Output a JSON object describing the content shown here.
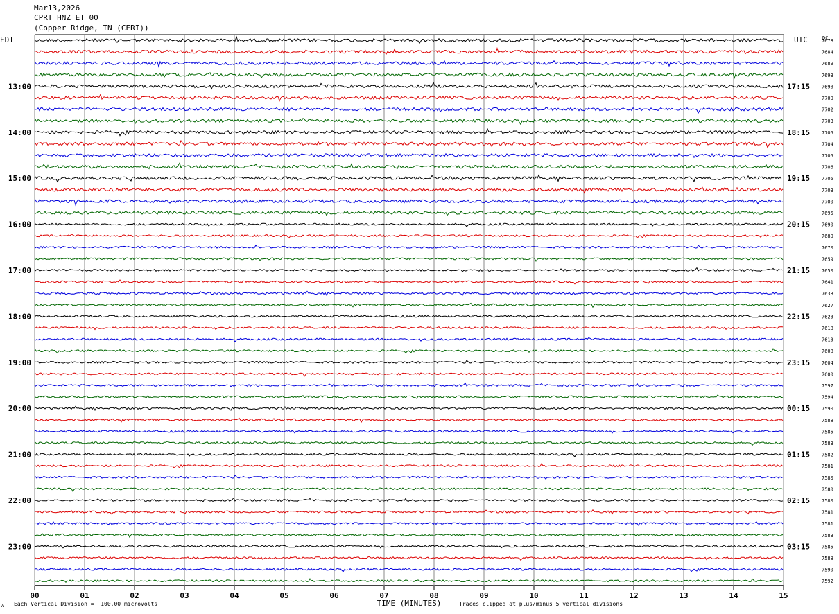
{
  "header": {
    "date": "Mar13,2026",
    "station": "CPRT HNZ ET 00",
    "location": "(Copper Ridge, TN (CERI))"
  },
  "footer": {
    "scale_note": "Each Vertical Division =  100.00 microvolts",
    "clip_note": "Traces clipped at plus/minus 5 vertical divisions",
    "corner_mark": "A"
  },
  "colors": {
    "trace_cycle": [
      "#000000",
      "#dd0000",
      "#0000dd",
      "#006600"
    ],
    "grid": "#888888"
  },
  "chart_data": {
    "type": "line",
    "title": "",
    "xlabel": "TIME (MINUTES)",
    "ylabel": "",
    "left_axis_label": "EDT",
    "right_axis_label": "UTC",
    "dc_label": "DC",
    "xlim": [
      0,
      15
    ],
    "x_ticks": [
      "00",
      "01",
      "02",
      "03",
      "04",
      "05",
      "06",
      "07",
      "08",
      "09",
      "10",
      "11",
      "12",
      "13",
      "14",
      "15"
    ],
    "grid": true,
    "rows_per_hour": 4,
    "rows": [
      {
        "dc": "7678"
      },
      {
        "dc": "7684"
      },
      {
        "dc": "7689"
      },
      {
        "dc": "7693"
      },
      {
        "dc": "7698",
        "edt": "13:00",
        "utc": "17:15"
      },
      {
        "dc": "7700"
      },
      {
        "dc": "7702"
      },
      {
        "dc": "7703"
      },
      {
        "dc": "7705",
        "edt": "14:00",
        "utc": "18:15"
      },
      {
        "dc": "7704"
      },
      {
        "dc": "7705"
      },
      {
        "dc": "7706"
      },
      {
        "dc": "7705",
        "edt": "15:00",
        "utc": "19:15"
      },
      {
        "dc": "7703"
      },
      {
        "dc": "7700"
      },
      {
        "dc": "7695"
      },
      {
        "dc": "7690",
        "edt": "16:00",
        "utc": "20:15"
      },
      {
        "dc": "7680"
      },
      {
        "dc": "7670"
      },
      {
        "dc": "7659"
      },
      {
        "dc": "7650",
        "edt": "17:00",
        "utc": "21:15"
      },
      {
        "dc": "7641"
      },
      {
        "dc": "7633"
      },
      {
        "dc": "7627"
      },
      {
        "dc": "7623",
        "edt": "18:00",
        "utc": "22:15"
      },
      {
        "dc": "7618"
      },
      {
        "dc": "7613"
      },
      {
        "dc": "7608"
      },
      {
        "dc": "7604",
        "edt": "19:00",
        "utc": "23:15"
      },
      {
        "dc": "7600"
      },
      {
        "dc": "7597"
      },
      {
        "dc": "7594"
      },
      {
        "dc": "7590",
        "edt": "20:00",
        "utc": "00:15"
      },
      {
        "dc": "7588"
      },
      {
        "dc": "7585"
      },
      {
        "dc": "7583"
      },
      {
        "dc": "7582",
        "edt": "21:00",
        "utc": "01:15"
      },
      {
        "dc": "7581"
      },
      {
        "dc": "7580"
      },
      {
        "dc": "7580"
      },
      {
        "dc": "7580",
        "edt": "22:00",
        "utc": "02:15"
      },
      {
        "dc": "7581"
      },
      {
        "dc": "7581"
      },
      {
        "dc": "7583"
      },
      {
        "dc": "7585",
        "edt": "23:00",
        "utc": "03:15"
      },
      {
        "dc": "7588"
      },
      {
        "dc": "7590"
      },
      {
        "dc": "7592"
      }
    ]
  }
}
